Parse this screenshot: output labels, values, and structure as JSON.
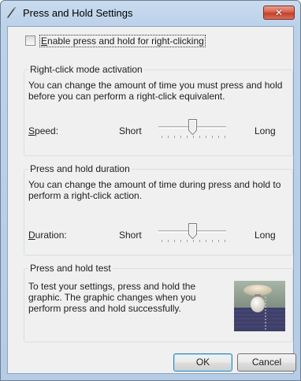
{
  "window": {
    "title": "Press and Hold Settings",
    "close_label": "✕"
  },
  "enable_checkbox": {
    "label": "Enable press and hold for right-clicking",
    "checked": false
  },
  "activation_group": {
    "title": "Right-click mode activation",
    "description": "You can change the amount of time you must press and hold before you can perform a right-click equivalent.",
    "row_label": "Speed:",
    "row_label_mnemonic": "S",
    "row_label_rest": "peed:",
    "min_label": "Short",
    "max_label": "Long",
    "slider_value": 0.5
  },
  "duration_group": {
    "title": "Press and hold duration",
    "description": "You can change the amount of time during press and hold to perform a right-click action.",
    "row_label": "Duration:",
    "row_label_mnemonic": "D",
    "row_label_rest": "uration:",
    "min_label": "Short",
    "max_label": "Long",
    "slider_value": 0.5
  },
  "test_group": {
    "title": "Press and hold test",
    "description": "To test your settings, press and hold the graphic. The graphic changes when you perform press and hold successfully."
  },
  "buttons": {
    "ok_label": "OK",
    "cancel_label": "Cancel"
  },
  "colors": {
    "accent": "#3c7fb1",
    "close": "#c4402a",
    "window_frame": "#bcd2ea"
  }
}
